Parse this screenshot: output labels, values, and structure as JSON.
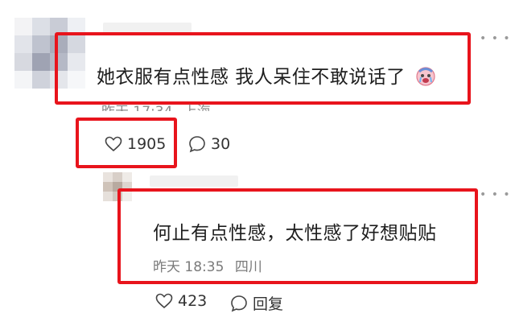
{
  "comment": {
    "text": "她衣服有点性感 我人呆住不敢说话了",
    "emoji_icon": "crying-face-emoji-icon",
    "time": "昨天 17:34",
    "location": "上海",
    "likes": "1905",
    "replies": "30",
    "more_icon": "more-dots-icon"
  },
  "reply": {
    "text": "何止有点性感，太性感了好想贴贴",
    "time": "昨天 18:35",
    "location": "四川",
    "likes": "423",
    "reply_label": "回复",
    "more_icon": "more-dots-icon"
  },
  "colors": {
    "highlight": "#e8141c",
    "meta_text": "#8a8a8a"
  }
}
